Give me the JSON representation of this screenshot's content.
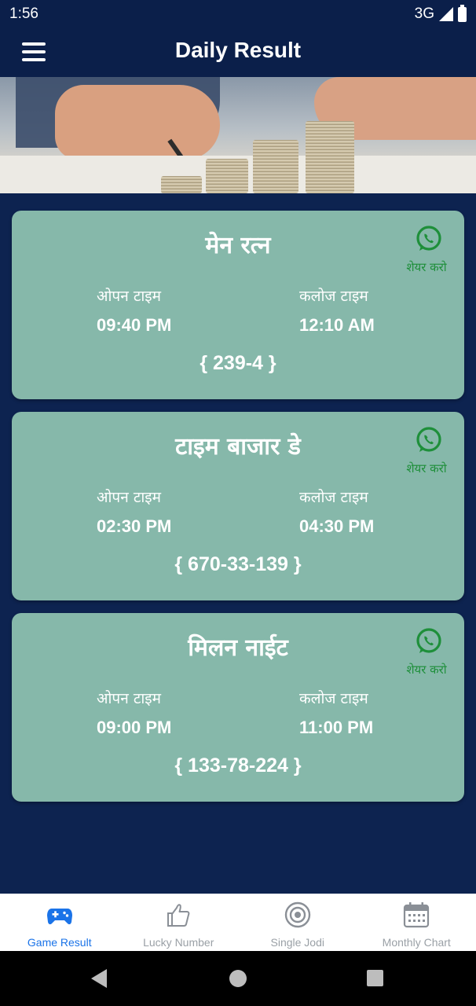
{
  "status_bar": {
    "time": "1:56",
    "network": "3G"
  },
  "app_bar": {
    "title": "Daily Result",
    "menu_icon": "hamburger-menu-icon"
  },
  "banner": {
    "image": "coins-stack-hand-photo"
  },
  "colors": {
    "background": "#0d2350",
    "card": "#86b8aa",
    "share": "#1e8f3a",
    "active_nav": "#1a73e8"
  },
  "cards": [
    {
      "title": "मेन रत्न",
      "share_label": "शेयर करो",
      "open_label": "ओपन टाइम",
      "open_time": "09:40 PM",
      "close_label": "कलोज टाइम",
      "close_time": "12:10 AM",
      "result": "{ 239-4 }"
    },
    {
      "title": "टाइम बाजार डे",
      "share_label": "शेयर करो",
      "open_label": "ओपन टाइम",
      "open_time": "02:30 PM",
      "close_label": "कलोज टाइम",
      "close_time": "04:30 PM",
      "result": "{ 670-33-139 }"
    },
    {
      "title": "मिलन नाईट",
      "share_label": "शेयर करो",
      "open_label": "ओपन टाइम",
      "open_time": "09:00 PM",
      "close_label": "कलोज टाइम",
      "close_time": "11:00 PM",
      "result": "{ 133-78-224 }"
    }
  ],
  "bottom_nav": [
    {
      "label": "Game Result",
      "icon": "gamepad-icon",
      "active": true
    },
    {
      "label": "Lucky Number",
      "icon": "thumbs-up-icon",
      "active": false
    },
    {
      "label": "Single Jodi",
      "icon": "target-icon",
      "active": false
    },
    {
      "label": "Monthly Chart",
      "icon": "calendar-icon",
      "active": false
    }
  ]
}
